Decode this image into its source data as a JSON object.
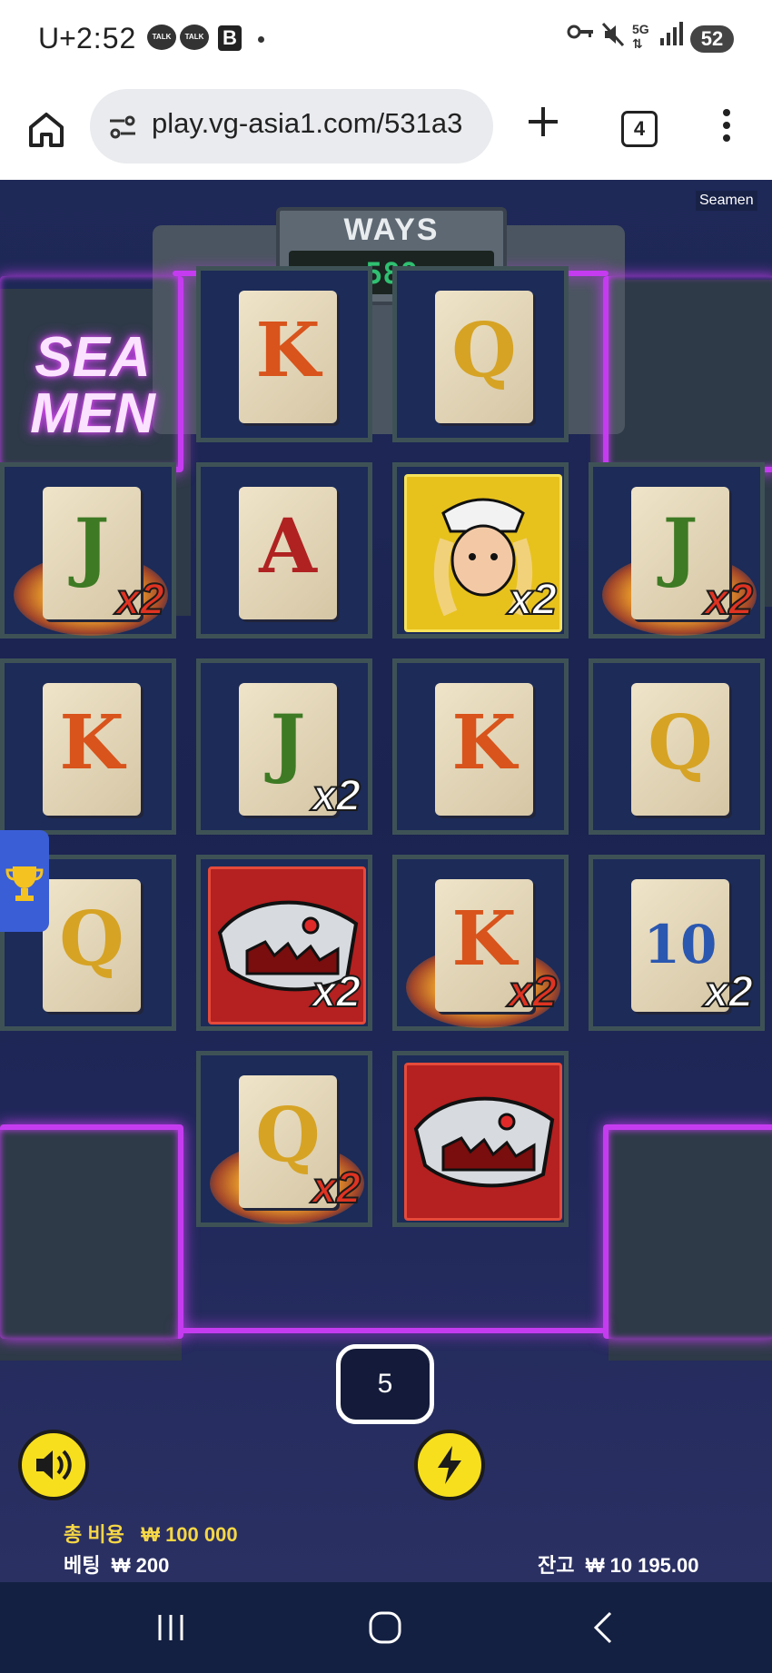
{
  "status_bar": {
    "carrier": "U+",
    "time": "2:52",
    "notif_icons": [
      "TALK",
      "TALK"
    ],
    "battery": "52"
  },
  "browser": {
    "url": "play.vg-asia1.com/531a3",
    "tab_count": "4"
  },
  "game": {
    "name_tag": "Seamen",
    "logo_line1": "SEA",
    "logo_line2": "MEN",
    "ways_label": "WAYS",
    "ways_value": "588",
    "spins_left": "5",
    "total_cost_label": "총 비용",
    "total_cost_value": "₩ 100 000",
    "bet_label": "베팅",
    "bet_value": "₩ 200",
    "balance_label": "잔고",
    "balance_value": "₩ 10 195.00",
    "symbol_colors": {
      "K": "#d8541c",
      "Q": "#d6a324",
      "J": "#3e7a24",
      "A": "#b02222",
      "10": "#2a57b0",
      "multiplier_white": "#ffffff",
      "multiplier_red": "#e03322"
    },
    "grid": [
      [
        null,
        {
          "sym": "K"
        },
        {
          "sym": "Q"
        },
        null
      ],
      [
        {
          "sym": "J",
          "mult": "x2",
          "fire": true,
          "mult_color": "red"
        },
        {
          "sym": "A"
        },
        {
          "sym": "sailor-girl",
          "mult": "x2",
          "mult_color": "white"
        },
        {
          "sym": "J",
          "mult": "x2",
          "fire": true,
          "mult_color": "red"
        }
      ],
      [
        {
          "sym": "K"
        },
        {
          "sym": "J",
          "mult": "x2",
          "mult_color": "white"
        },
        {
          "sym": "K"
        },
        {
          "sym": "Q"
        }
      ],
      [
        {
          "sym": "Q"
        },
        {
          "sym": "shark",
          "mult": "x2",
          "mult_color": "white"
        },
        {
          "sym": "K",
          "mult": "x2",
          "fire": true,
          "mult_color": "red"
        },
        {
          "sym": "10",
          "mult": "x2",
          "mult_color": "white"
        }
      ],
      [
        null,
        {
          "sym": "Q",
          "mult": "x2",
          "fire": true,
          "mult_color": "red"
        },
        {
          "sym": "shark"
        },
        null
      ]
    ]
  }
}
